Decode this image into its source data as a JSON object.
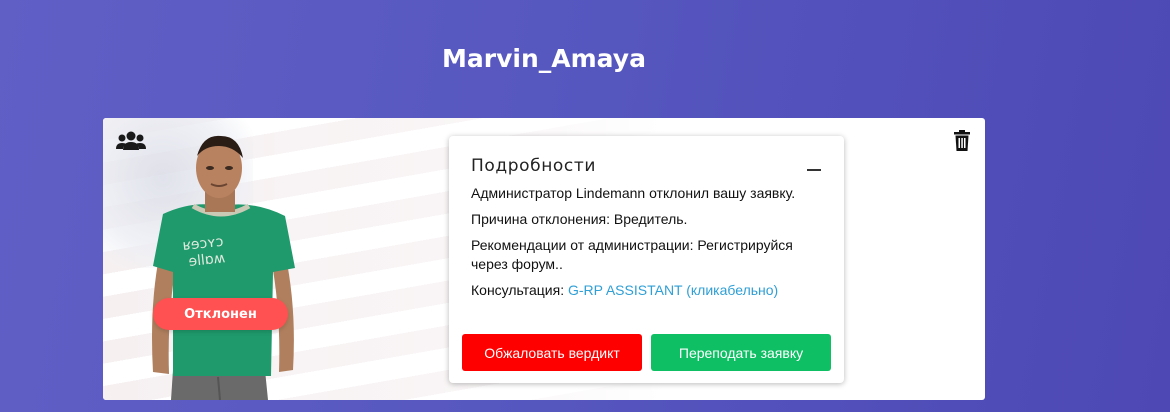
{
  "player_name": "Marvin_Amaya",
  "card": {
    "status": "Отклонен",
    "icons": {
      "group": "group-icon",
      "delete": "trash-icon"
    }
  },
  "details": {
    "title": "Подробности",
    "collapse_icon": "minus-icon",
    "lines": [
      "Администратор Lindemann отклонил вашу заявку.",
      "Причина отклонения: Вредитель.",
      "Рекомендации от администрации: Регистрируйся через форум.."
    ],
    "consultation_label": "Консультация: ",
    "consultation_link": "G-RP ASSISTANT (кликабельно)",
    "buttons": {
      "appeal": "Обжаловать вердикт",
      "resubmit": "Переподать заявку"
    }
  },
  "colors": {
    "background": "#5858c0",
    "status_pill": "#ff5151",
    "appeal_button": "#ff0000",
    "resubmit_button": "#0fbf63",
    "link": "#2f9fd6"
  }
}
